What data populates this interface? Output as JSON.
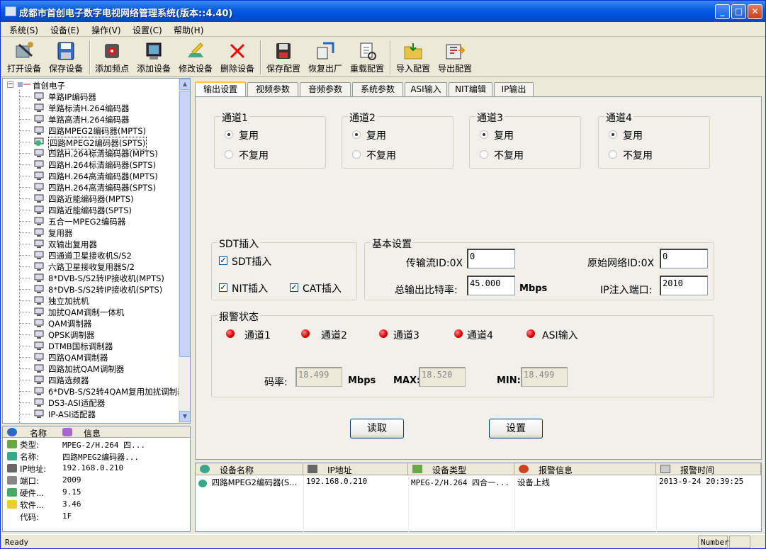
{
  "window": {
    "title": "成都市首创电子数字电视网络管理系统(版本::4.40)"
  },
  "menu": [
    "系统(S)",
    "设备(E)",
    "操作(V)",
    "设置(C)",
    "帮助(H)"
  ],
  "toolbar": [
    "打开设备",
    "保存设备",
    "添加频点",
    "添加设备",
    "修改设备",
    "删除设备",
    "保存配置",
    "恢复出厂",
    "重载配置",
    "导入配置",
    "导出配置"
  ],
  "tree": {
    "root": "首创电子",
    "items": [
      "单路IP编码器",
      "单路标清H.264编码器",
      "单路高清H.264编码器",
      "四路MPEG2编码器(MPTS)",
      "四路MPEG2编码器(SPTS)",
      "四路H.264标清编码器(MPTS)",
      "四路H.264标清编码器(SPTS)",
      "四路H.264高清编码器(MPTS)",
      "四路H.264高清编码器(SPTS)",
      "四路近能编码器(MPTS)",
      "四路近能编码器(SPTS)",
      "五合一MPEG2编码器",
      "复用器",
      "双输出复用器",
      "四通道卫星接收机S/S2",
      "六路卫星接收复用器S/2",
      "8*DVB-S/S2转IP接收机(MPTS)",
      "8*DVB-S/S2转IP接收机(SPTS)",
      "独立加扰机",
      "加扰QAM调制一体机",
      "QAM调制器",
      "QPSK调制器",
      "DTMB国标调制器",
      "四路QAM调制器",
      "四路加扰QAM调制器",
      "四路选频器",
      "6*DVB-S/S2转4QAM复用加扰调制器",
      "DS3-ASI适配器",
      "IP-ASI适配器"
    ],
    "selected": 4
  },
  "info": {
    "headers": [
      "名称",
      "信息"
    ],
    "rows": [
      {
        "k": "类型:",
        "v": "MPEG-2/H.264 四..."
      },
      {
        "k": "名称:",
        "v": "四路MPEG2编码器..."
      },
      {
        "k": "IP地址:",
        "v": "192.168.0.210"
      },
      {
        "k": "端口:",
        "v": "2009"
      },
      {
        "k": "硬件...",
        "v": "9.15"
      },
      {
        "k": "软件...",
        "v": "3.46"
      },
      {
        "k": "代码:",
        "v": "1F"
      }
    ]
  },
  "tabs": [
    "输出设置",
    "视频参数",
    "音频参数",
    "系统参数",
    "ASI输入",
    "NIT编辑",
    "IP输出"
  ],
  "channels": [
    {
      "name": "通道1",
      "opt1": "复用",
      "opt2": "不复用"
    },
    {
      "name": "通道2",
      "opt1": "复用",
      "opt2": "不复用"
    },
    {
      "name": "通道3",
      "opt1": "复用",
      "opt2": "不复用"
    },
    {
      "name": "通道4",
      "opt1": "复用",
      "opt2": "不复用"
    }
  ],
  "sdt": {
    "title": "SDT插入",
    "sdt": "SDT插入",
    "nit": "NIT插入",
    "cat": "CAT插入"
  },
  "basic": {
    "title": "基本设置",
    "tsid_label": "传输流ID:0X",
    "tsid": "0",
    "onid_label": "原始网络ID:0X",
    "onid": "0",
    "bitrate_label": "总输出比特率:",
    "bitrate": "45.000",
    "bitrate_unit": "Mbps",
    "port_label": "IP注入端口:",
    "port": "2010"
  },
  "alarm": {
    "title": "报警状态",
    "leds": [
      "通道1",
      "通道2",
      "通道3",
      "通道4",
      "ASI输入"
    ],
    "rate_label": "码率:",
    "rate": "18.499",
    "rate_unit": "Mbps",
    "max_label": "MAX:",
    "max": "18.520",
    "min_label": "MIN:",
    "min": "18.499"
  },
  "buttons": {
    "read": "读取",
    "set": "设置"
  },
  "list": {
    "headers": [
      "设备名称",
      "IP地址",
      "设备类型",
      "报警信息",
      "报警时间"
    ],
    "row": [
      "四路MPEG2编码器(S...",
      "192.168.0.210",
      "MPEG-2/H.264 四合一...",
      "设备上线",
      "2013-9-24 20:39:25"
    ]
  },
  "status": {
    "left": "Ready",
    "right": "Number"
  }
}
